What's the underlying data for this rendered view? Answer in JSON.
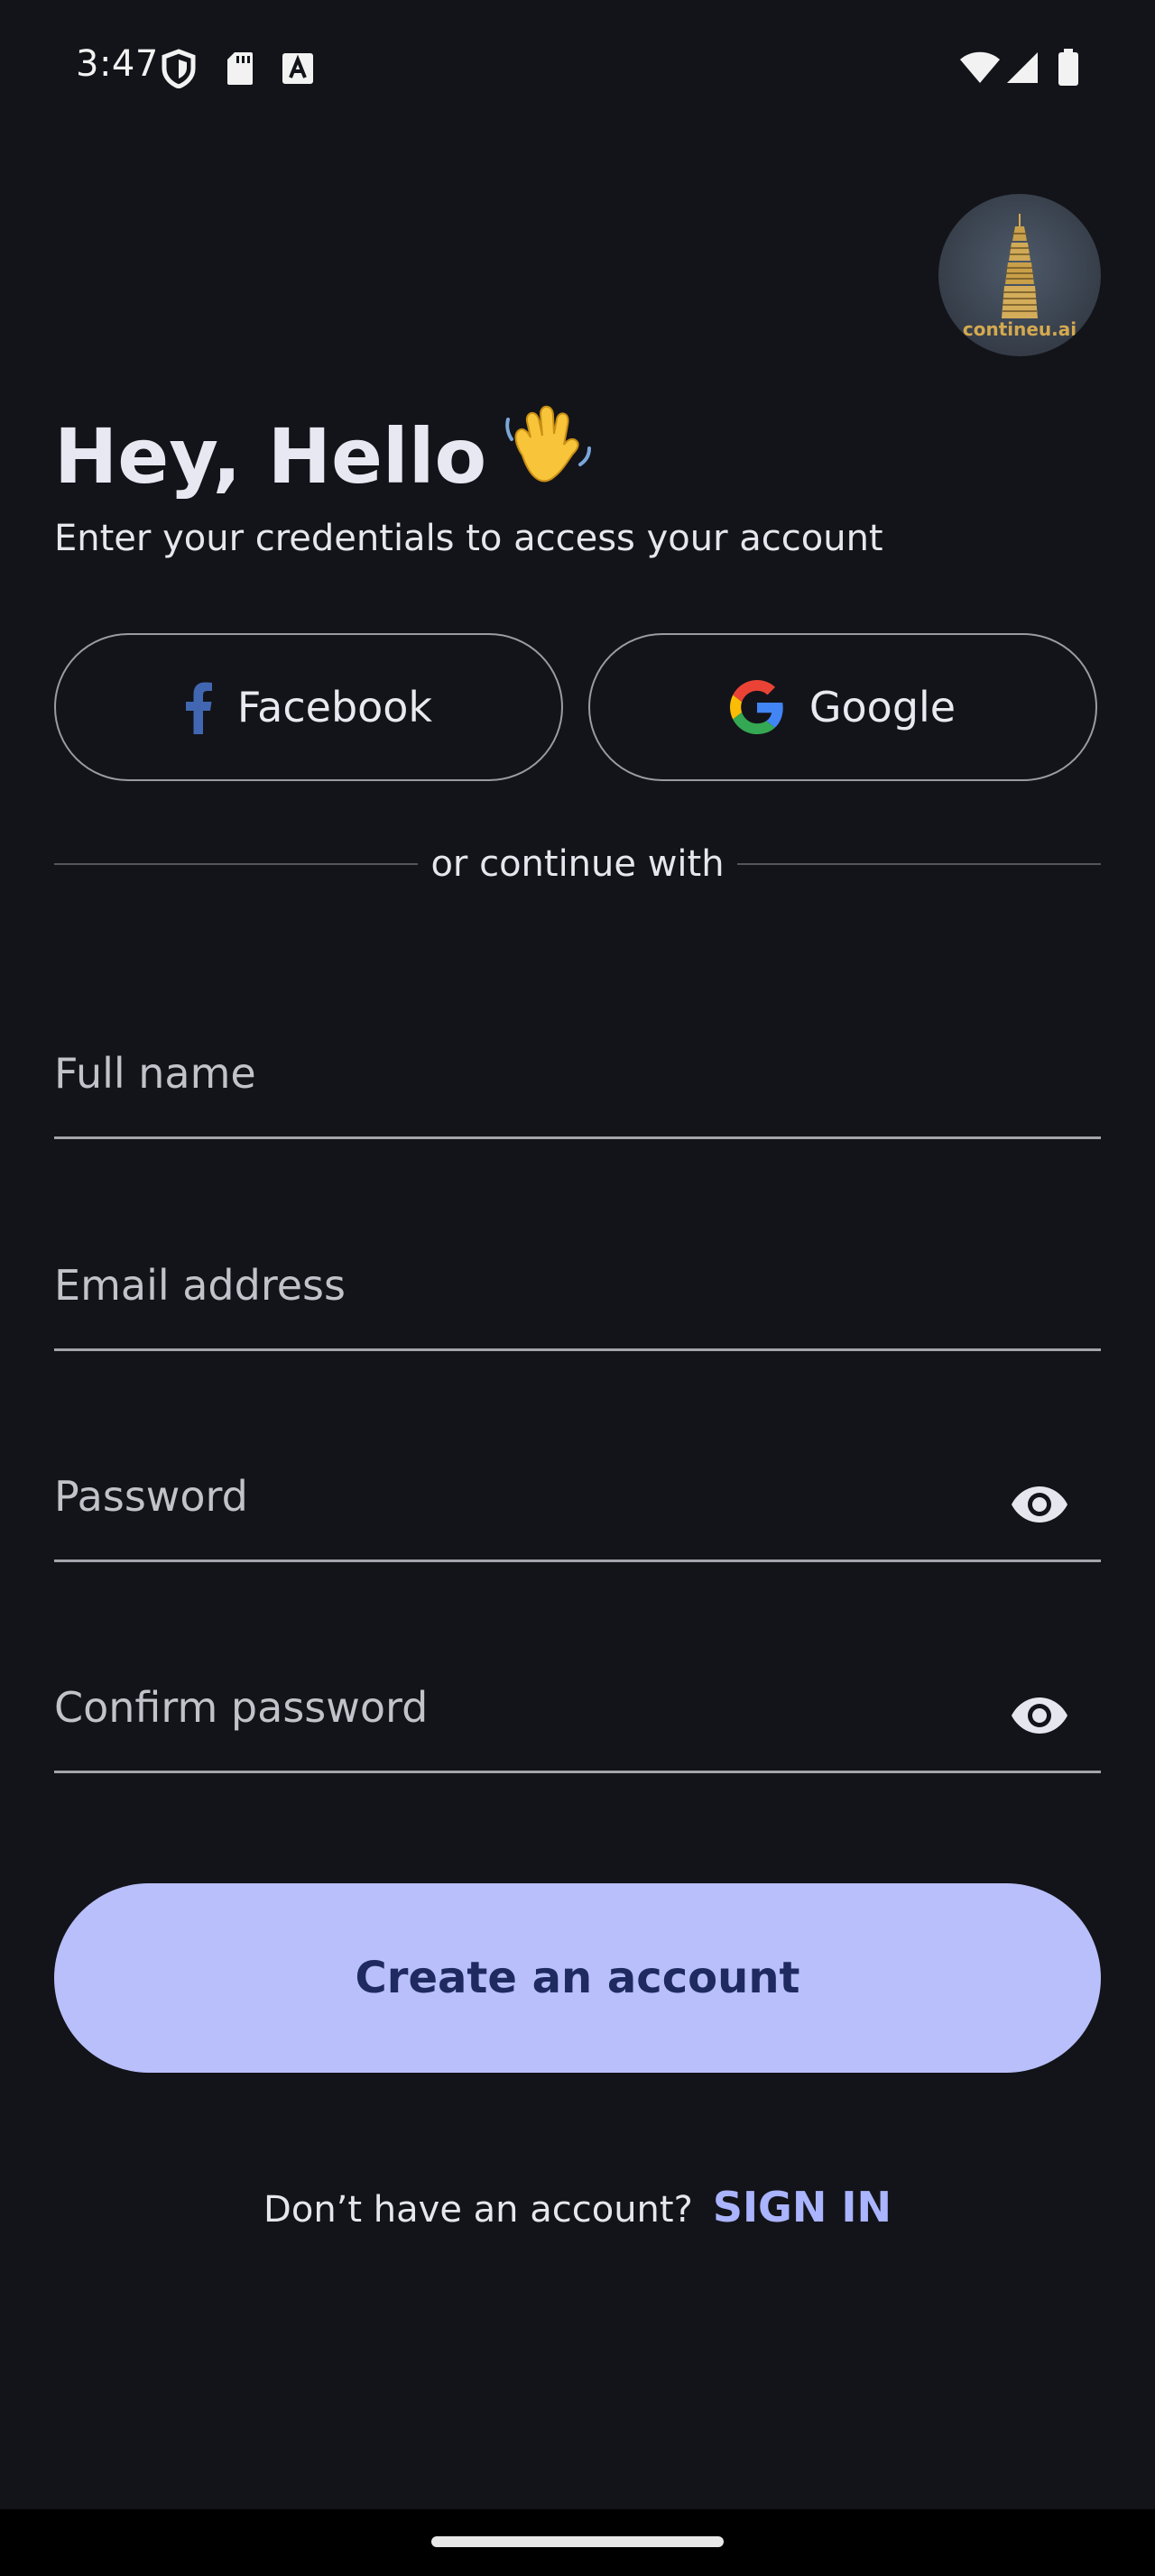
{
  "status_bar": {
    "time": "3:47",
    "icons_left": [
      "shield-icon",
      "sd-card-icon",
      "font-icon"
    ],
    "icons_right": [
      "wifi-icon",
      "signal-icon",
      "battery-icon"
    ]
  },
  "logo": {
    "text": "contineu.ai",
    "icon": "building-logo-icon"
  },
  "header": {
    "greeting": "Hey, Hello",
    "greeting_emoji_icon": "waving-hand-icon",
    "subtitle": "Enter your credentials to access your account"
  },
  "social": {
    "facebook_label": "Facebook",
    "google_label": "Google"
  },
  "divider_text": "or continue with",
  "form": {
    "full_name_placeholder": "Full name",
    "email_placeholder": "Email address",
    "password_placeholder": "Password",
    "confirm_password_placeholder": "Confirm password"
  },
  "primary_button_label": "Create an account",
  "footer": {
    "question": "Don’t have an account?",
    "link_label": "SIGN IN"
  },
  "colors": {
    "background": "#131419",
    "primary_button": "#b8bffa",
    "primary_button_text": "#1f2a60",
    "link": "#aab4ff",
    "facebook_blue": "#4267b2"
  }
}
